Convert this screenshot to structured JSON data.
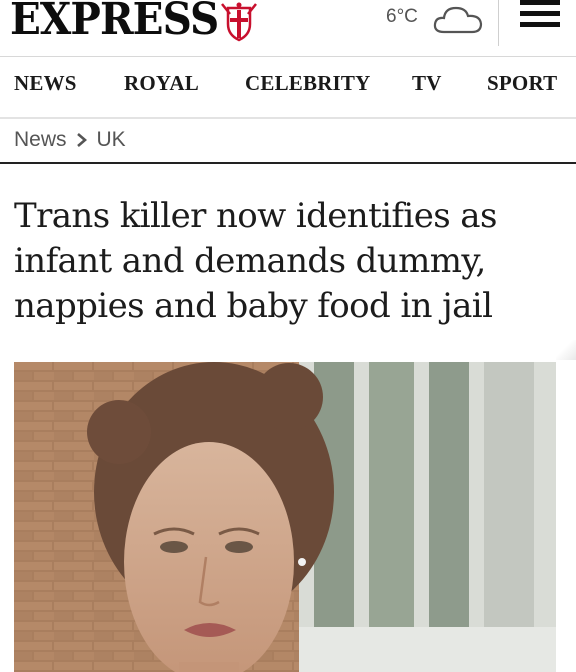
{
  "header": {
    "logo_text": "EXPRESS",
    "weather": {
      "temperature": "6°C",
      "icon": "cloud-icon"
    },
    "menu_icon": "hamburger-menu-icon"
  },
  "nav": {
    "items": [
      {
        "label": "NEWS"
      },
      {
        "label": "ROYAL"
      },
      {
        "label": "CELEBRITY"
      },
      {
        "label": "TV"
      },
      {
        "label": "SPORT"
      }
    ]
  },
  "breadcrumb": {
    "section": "News",
    "subsection": "UK"
  },
  "article": {
    "headline": "Trans killer now identifies as infant and demands dummy, nappies and baby food in jail"
  },
  "colors": {
    "text": "#111111",
    "logo_red": "#c8102e",
    "nav_border": "#e3e3e3"
  }
}
